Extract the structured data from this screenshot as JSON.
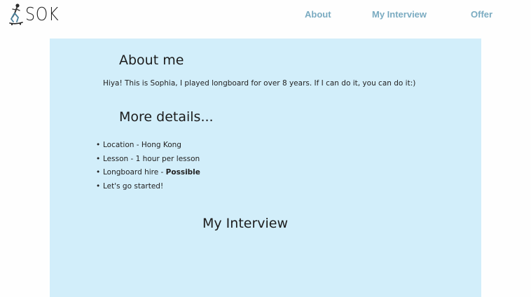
{
  "header": {
    "logo_text": "SOK",
    "logo_icon": "skater-icon",
    "nav": [
      {
        "label": "About"
      },
      {
        "label": "My Interview"
      },
      {
        "label": "Offer"
      }
    ],
    "nav_color": "#7aabc1"
  },
  "main": {
    "background": "#d2eefa",
    "about_heading": "About me",
    "intro": "Hiya! This is Sophia, I played longboard for over 8 years. If I can do it, you can do it:)",
    "details_heading": "More details...",
    "details": [
      {
        "text": "Location - Hong Kong",
        "bold": ""
      },
      {
        "text": "Lesson - 1 hour per lesson",
        "bold": ""
      },
      {
        "text": "Longboard hire - ",
        "bold": "Possible"
      },
      {
        "text": "Let's go started!",
        "bold": ""
      }
    ],
    "interview_heading": "My Interview"
  }
}
